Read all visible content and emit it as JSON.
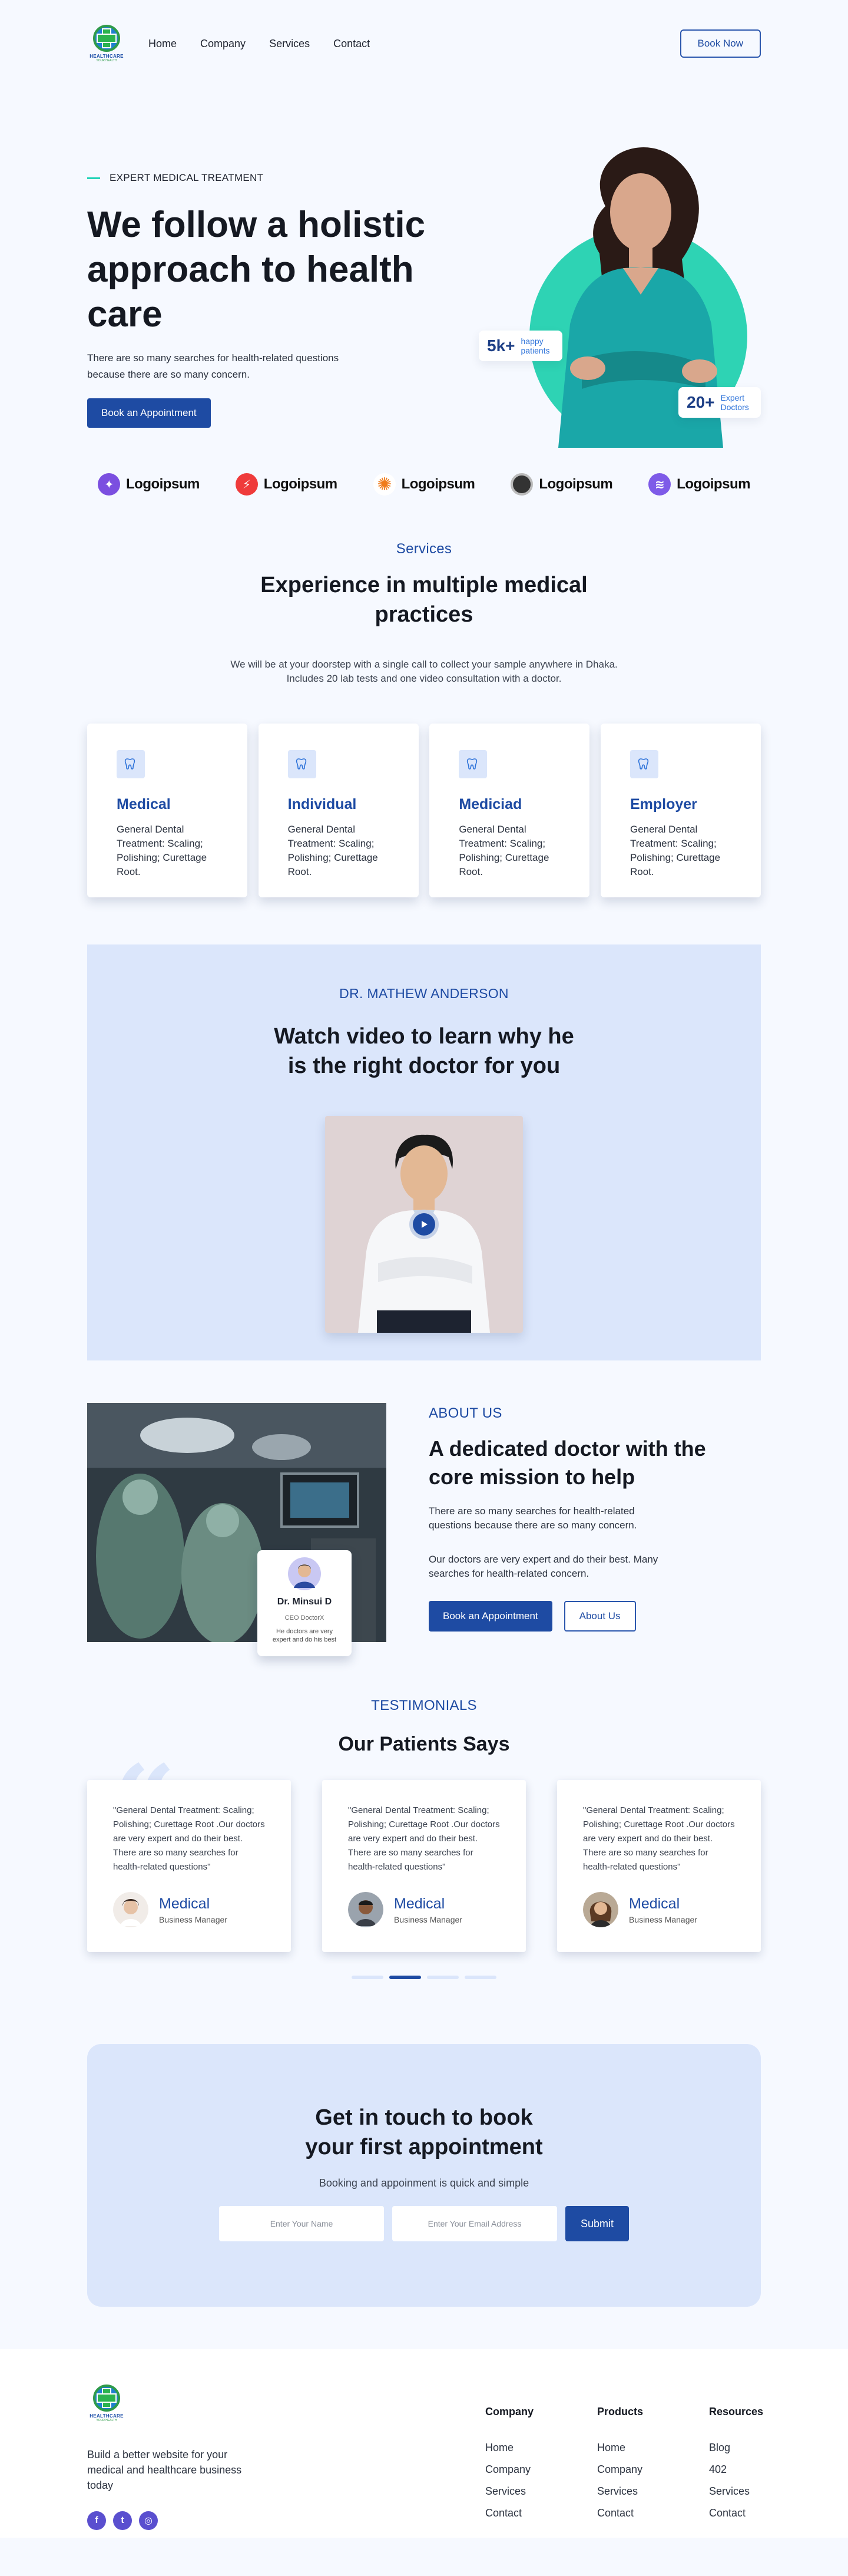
{
  "brand": {
    "name": "HEALTHCARE",
    "sub": "YOUR HEALTH"
  },
  "nav": {
    "links": [
      "Home",
      "Company",
      "Services",
      "Contact"
    ],
    "cta": "Book Now"
  },
  "hero": {
    "eyebrow": "EXPERT MEDICAL TREATMENT",
    "title": "We follow a holistic approach to health care",
    "desc": "There are so many searches for health-related questions because there are so many concern.",
    "cta": "Book an Appointment",
    "badge_patients": {
      "num": "5k+",
      "label": "happy patients"
    },
    "badge_doctors": {
      "num": "20+",
      "label": "Expert Doctors"
    }
  },
  "logos": [
    "Logoipsum",
    "Logoipsum",
    "Logoipsum",
    "Logoipsum",
    "Logoipsum"
  ],
  "services": {
    "kicker": "Services",
    "title": "Experience in multiple medical practices",
    "desc": "We will be at your doorstep with a single call to collect your sample anywhere in Dhaka. Includes 20 lab tests and one video consultation with a doctor.",
    "cards": [
      {
        "title": "Medical",
        "text": "General Dental Treatment: Scaling; Polishing; Curettage Root."
      },
      {
        "title": "Individual",
        "text": "General Dental Treatment: Scaling; Polishing; Curettage Root."
      },
      {
        "title": "Mediciad",
        "text": "General Dental Treatment: Scaling; Polishing; Curettage Root."
      },
      {
        "title": "Employer",
        "text": "General Dental Treatment: Scaling; Polishing; Curettage Root."
      }
    ]
  },
  "video": {
    "kicker": "DR. MATHEW ANDERSON",
    "title": "Watch video to learn why he is the right doctor for you"
  },
  "about": {
    "kicker": "ABOUT US",
    "title": "A dedicated doctor with the core mission to help",
    "p1": "There are so many searches for health-related questions because there are so many concern.",
    "p2": "Our doctors are very expert and do their best. Many searches for health-related concern.",
    "cta_primary": "Book an Appointment",
    "cta_secondary": "About Us",
    "doctor": {
      "name": "Dr. Minsui D",
      "role": "CEO DoctorX",
      "note": "He doctors are very expert and do his best"
    }
  },
  "testimonials": {
    "kicker": "TESTIMONIALS",
    "title": "Our Patients Says",
    "items": [
      {
        "quote": "\"General Dental Treatment: Scaling; Polishing; Curettage Root .Our doctors are very expert and do their best. There are so many searches for health-related questions\"",
        "name": "Medical",
        "role": "Business Manager"
      },
      {
        "quote": "\"General Dental Treatment: Scaling; Polishing; Curettage Root .Our doctors are very expert and do their best. There are so many searches for health-related questions\"",
        "name": "Medical",
        "role": "Business Manager"
      },
      {
        "quote": "\"General Dental Treatment: Scaling; Polishing; Curettage Root .Our doctors are very expert and do their best. There are so many searches for health-related questions\"",
        "name": "Medical",
        "role": "Business Manager"
      }
    ]
  },
  "cta": {
    "title": "Get in touch to book your first appointment",
    "sub": "Booking and appoinment is quick and simple",
    "name_placeholder": "Enter Your Name",
    "email_placeholder": "Enter Your Email Address",
    "submit": "Submit"
  },
  "footer": {
    "tagline": "Build a better website for your medical and healthcare business today",
    "columns": [
      {
        "title": "Company",
        "links": [
          "Home",
          "Company",
          "Services",
          "Contact"
        ]
      },
      {
        "title": "Products",
        "links": [
          "Home",
          "Company",
          "Services",
          "Contact"
        ]
      },
      {
        "title": "Resources",
        "links": [
          "Blog",
          "402",
          "Services",
          "Contact"
        ]
      }
    ]
  },
  "colors": {
    "primary": "#1e4ba3",
    "accent": "#2ed3b4",
    "tint": "#dbe6fb"
  }
}
